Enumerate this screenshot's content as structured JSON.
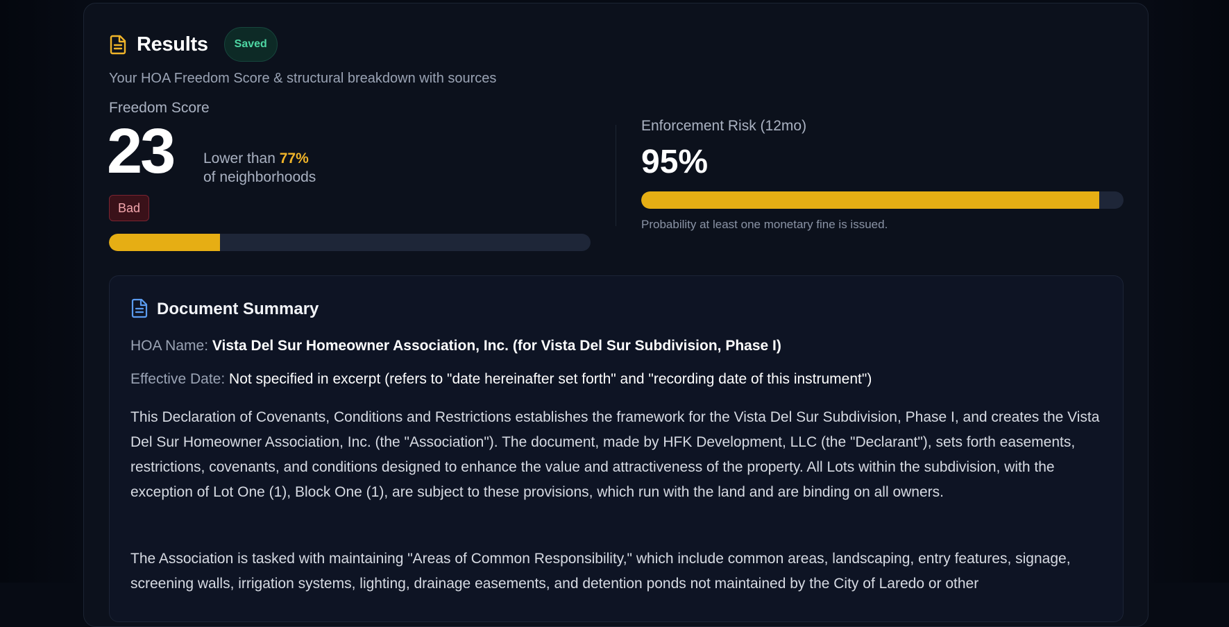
{
  "results": {
    "title": "Results",
    "saved_badge": "Saved",
    "subtitle": "Your HOA Freedom Score & structural breakdown with sources"
  },
  "freedom_score": {
    "label": "Freedom Score",
    "value": "23",
    "compare_prefix": "Lower than",
    "compare_percent": "77%",
    "compare_suffix": "of neighborhoods",
    "rating": "Bad",
    "bar_fraction": 0.23
  },
  "enforcement_risk": {
    "label": "Enforcement Risk (12mo)",
    "value": "95%",
    "bar_fraction": 0.95,
    "note": "Probability at least one monetary fine is issued."
  },
  "document_summary": {
    "title": "Document Summary",
    "hoa_name_label": "HOA Name:",
    "hoa_name_value": "Vista Del Sur Homeowner Association, Inc. (for Vista Del Sur Subdivision, Phase I)",
    "effective_date_label": "Effective Date:",
    "effective_date_value": "Not specified in excerpt (refers to \"date hereinafter set forth\" and \"recording date of this instrument\")",
    "paragraph_1": "This Declaration of Covenants, Conditions and Restrictions establishes the framework for the Vista Del Sur Subdivision, Phase I, and creates the Vista Del Sur Homeowner Association, Inc. (the \"Association\"). The document, made by HFK Development, LLC (the \"Declarant\"), sets forth easements, restrictions, covenants, and conditions designed to enhance the value and attractiveness of the property. All Lots within the subdivision, with the exception of Lot One (1), Block One (1), are subject to these provisions, which run with the land and are binding on all owners.",
    "paragraph_2": "The Association is tasked with maintaining \"Areas of Common Responsibility,\" which include common areas, landscaping, entry features, signage, screening walls, irrigation systems, lighting, drainage easements, and detention ponds not maintained by the City of Laredo or other"
  },
  "colors": {
    "accent": "#e6ae14",
    "saved": "#4ed6a3",
    "bad": "#f3a6ad",
    "summary_icon": "#5b9cf0"
  }
}
